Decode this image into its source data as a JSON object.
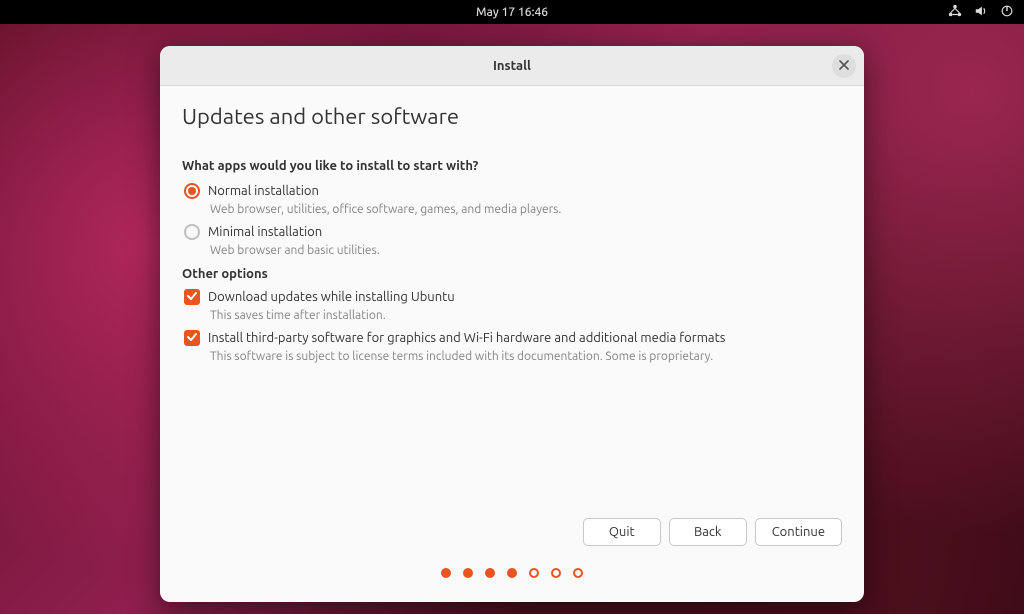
{
  "topbar": {
    "datetime": "May 17  16:46"
  },
  "window": {
    "title": "Install"
  },
  "page": {
    "heading": "Updates and other software",
    "question": "What apps would you like to install to start with?",
    "radios": [
      {
        "label": "Normal installation",
        "desc": "Web browser, utilities, office software, games, and media players.",
        "checked": true
      },
      {
        "label": "Minimal installation",
        "desc": "Web browser and basic utilities.",
        "checked": false
      }
    ],
    "other_heading": "Other options",
    "checks": [
      {
        "label": "Download updates while installing Ubuntu",
        "desc": "This saves time after installation.",
        "checked": true
      },
      {
        "label": "Install third-party software for graphics and Wi-Fi hardware and additional media formats",
        "desc": "This software is subject to license terms included with its documentation. Some is proprietary.",
        "checked": true
      }
    ]
  },
  "buttons": {
    "quit": "Quit",
    "back": "Back",
    "continue": "Continue"
  },
  "progress": {
    "total": 7,
    "current": 4
  }
}
